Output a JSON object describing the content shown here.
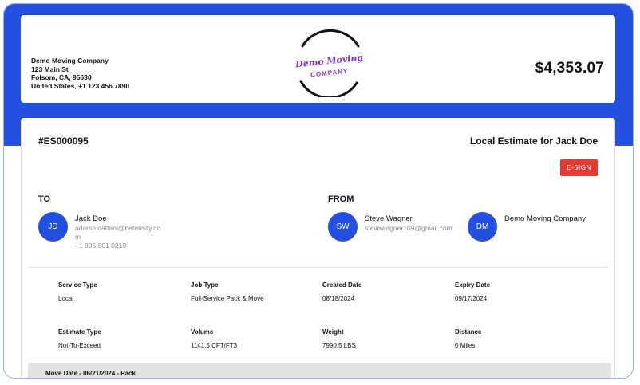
{
  "company": {
    "name": "Demo Moving Company",
    "street": "123 Main St",
    "city": "Folsom, CA, 95630",
    "country_phone": "United States, +1 123 456 7890",
    "logo_line1": "Demo Moving",
    "logo_line2": "COMPANY"
  },
  "total_amount": "$4,353.07",
  "estimate": {
    "number": "#ES000095",
    "title": "Local Estimate for Jack Doe",
    "esign_label": "E-SIGN"
  },
  "to": {
    "label": "TO",
    "initials": "JD",
    "name": "Jack Doe",
    "email_line1": "adarsh.dattani@netensity.co",
    "email_line2": "m",
    "phone": "+1 805 801 0219"
  },
  "from": {
    "label": "FROM",
    "agent_initials": "SW",
    "agent_name": "Steve Wagner",
    "agent_email": "stevewagner109@gmail.com",
    "company_initials": "DM",
    "company_name": "Demo Moving Company"
  },
  "details": {
    "service_type_label": "Service Type",
    "service_type": "Local",
    "job_type_label": "Job Type",
    "job_type": "Full-Service Pack & Move",
    "created_date_label": "Created Date",
    "created_date": "08/18/2024",
    "expiry_date_label": "Expiry Date",
    "expiry_date": "09/17/2024",
    "estimate_type_label": "Estimate Type",
    "estimate_type": "Not-To-Exceed",
    "volume_label": "Volume",
    "volume": "1141.5 CFT/FT3",
    "weight_label": "Weight",
    "weight": "7990.5 LBS",
    "distance_label": "Distance",
    "distance": "0 Miles"
  },
  "move_date": "Move Date - 06/21/2024 - Pack",
  "colors": {
    "brand_blue": "#2450e0",
    "esign_red": "#e53935",
    "logo_purple": "#7b2fd0"
  }
}
